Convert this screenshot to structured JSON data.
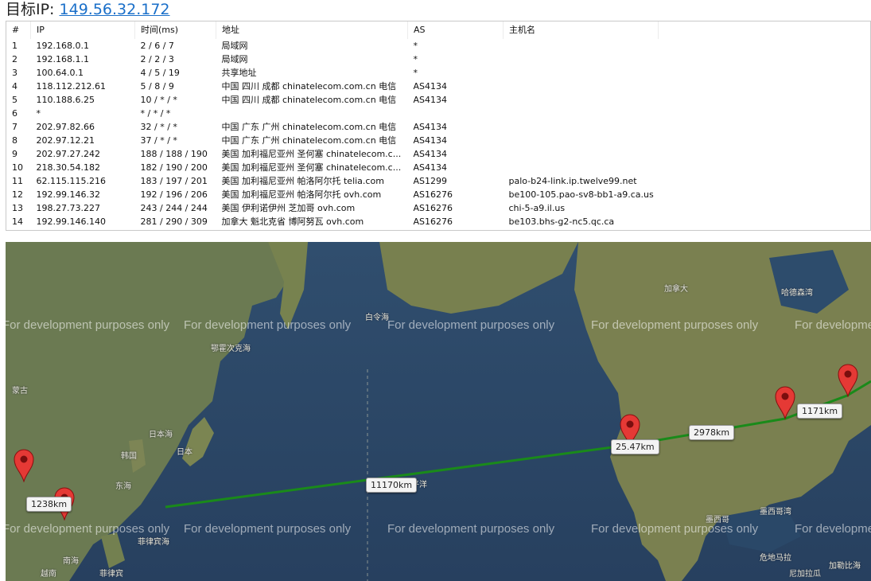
{
  "header": {
    "label": "目标IP:",
    "ip": "149.56.32.172"
  },
  "table": {
    "columns": [
      "#",
      "IP",
      "时间(ms)",
      "地址",
      "AS",
      "主机名"
    ],
    "rows": [
      [
        "1",
        "192.168.0.1",
        "2 / 6 / 7",
        "局域网",
        "*",
        ""
      ],
      [
        "2",
        "192.168.1.1",
        "2 / 2 / 3",
        "局域网",
        "*",
        ""
      ],
      [
        "3",
        "100.64.0.1",
        "4 / 5 / 19",
        "共享地址",
        "*",
        ""
      ],
      [
        "4",
        "118.112.212.61",
        "5 / 8 / 9",
        "中国 四川 成都 chinatelecom.com.cn 电信",
        "AS4134",
        ""
      ],
      [
        "5",
        "110.188.6.25",
        "10 / * / *",
        "中国 四川 成都 chinatelecom.com.cn 电信",
        "AS4134",
        ""
      ],
      [
        "6",
        "*",
        "* / * / *",
        "",
        "",
        ""
      ],
      [
        "7",
        "202.97.82.66",
        "32 / * / *",
        "中国 广东 广州 chinatelecom.com.cn 电信",
        "AS4134",
        ""
      ],
      [
        "8",
        "202.97.12.21",
        "37 / * / *",
        "中国 广东 广州 chinatelecom.com.cn 电信",
        "AS4134",
        ""
      ],
      [
        "9",
        "202.97.27.242",
        "188 / 188 / 190",
        "美国 加利福尼亚州 圣何塞 chinatelecom.c...",
        "AS4134",
        ""
      ],
      [
        "10",
        "218.30.54.182",
        "182 / 190 / 200",
        "美国 加利福尼亚州 圣何塞 chinatelecom.c...",
        "AS4134",
        ""
      ],
      [
        "11",
        "62.115.115.216",
        "183 / 197 / 201",
        "美国 加利福尼亚州 帕洛阿尔托 telia.com",
        "AS1299",
        "palo-b24-link.ip.twelve99.net"
      ],
      [
        "12",
        "192.99.146.32",
        "192 / 196 / 206",
        "美国 加利福尼亚州 帕洛阿尔托 ovh.com",
        "AS16276",
        "be100-105.pao-sv8-bb1-a9.ca.us"
      ],
      [
        "13",
        "198.27.73.227",
        "243 / 244 / 244",
        "美国 伊利诺伊州 芝加哥 ovh.com",
        "AS16276",
        "chi-5-a9.il.us"
      ],
      [
        "14",
        "192.99.146.140",
        "281 / 290 / 309",
        "加拿大 魁北克省 博阿努瓦 ovh.com",
        "AS16276",
        "be103.bhs-g2-nc5.qc.ca"
      ]
    ]
  },
  "map": {
    "distances": [
      "1238km",
      "11170km",
      "25.47km",
      "2978km",
      "1171km"
    ],
    "watermark": "For development purposes only",
    "labels": [
      "加拿大",
      "哈德森湾",
      "白令海",
      "鄂霍次克海",
      "日本海",
      "日本",
      "韩国",
      "蒙古",
      "东海",
      "南海",
      "菲律宾",
      "越南",
      "菲律宾海",
      "平洋",
      "墨西哥",
      "墨西哥湾",
      "危地马拉",
      "尼加拉瓜",
      "加勒比海"
    ],
    "route_color": "#1a8a1a",
    "pin_color": "#e53935"
  }
}
